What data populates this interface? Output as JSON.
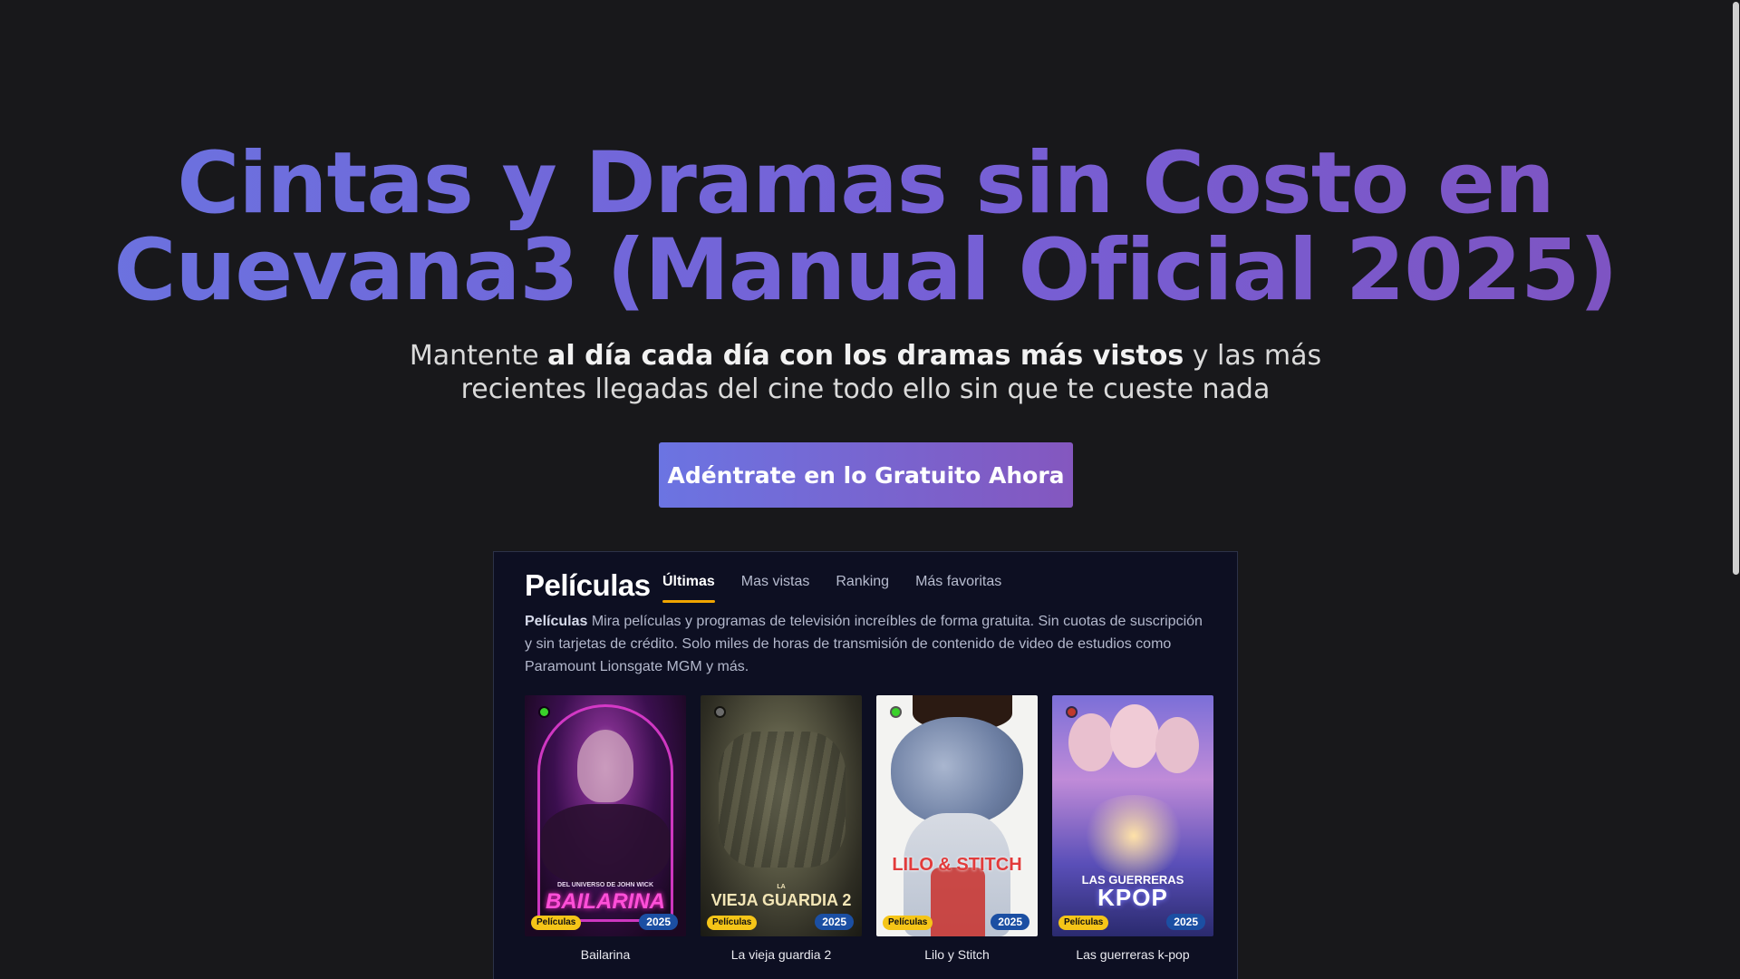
{
  "hero": {
    "title_line1": "Cintas y Dramas sin Costo en",
    "title_line2": "Cuevana3 (Manual Oficial 2025)",
    "subtitle_part1": "Mantente ",
    "subtitle_bold": "al día cada día con los dramas más vistos",
    "subtitle_part2": " y las más",
    "subtitle_line2": "recientes llegadas del cine todo ello sin que te cueste nada",
    "cta_label": "Adéntrate en lo Gratuito Ahora"
  },
  "panel": {
    "title": "Películas",
    "tabs": [
      {
        "label": "Últimas",
        "active": true
      },
      {
        "label": "Mas vistas",
        "active": false
      },
      {
        "label": "Ranking",
        "active": false
      },
      {
        "label": "Más favoritas",
        "active": false
      }
    ],
    "desc_bold": "Películas",
    "desc_text": " Mira películas y programas de televisión increíbles de forma gratuita. Sin cuotas de suscripción y sin tarjetas de crédito. Solo miles de horas de transmisión de contenido de video de estudios como Paramount Lionsgate MGM y más.",
    "movies": [
      {
        "title": "Bailarina",
        "category": "Películas",
        "year": "2025",
        "dot_color": "#3ad12a",
        "poster_text": "Bailarina",
        "poster_small": "Del universo de John Wick"
      },
      {
        "title": "La vieja guardia 2",
        "category": "Películas",
        "year": "2025",
        "dot_color": "#6b6b6b",
        "poster_text": "Vieja Guardia 2",
        "poster_small": "La"
      },
      {
        "title": "Lilo y Stitch",
        "category": "Películas",
        "year": "2025",
        "dot_color": "#3ad12a",
        "poster_text": "Lilo & Stitch",
        "poster_small": ""
      },
      {
        "title": "Las guerreras k-pop",
        "category": "Películas",
        "year": "2025",
        "dot_color": "#c0392b",
        "poster_text": "KPOP",
        "poster_small": "Las Guerreras"
      }
    ]
  },
  "colors": {
    "accent_gradient_start": "#6b74e2",
    "accent_gradient_end": "#8457bf",
    "tab_underline": "#f0a500",
    "category_badge": "#f5c518",
    "year_badge": "#1b4fa3"
  }
}
